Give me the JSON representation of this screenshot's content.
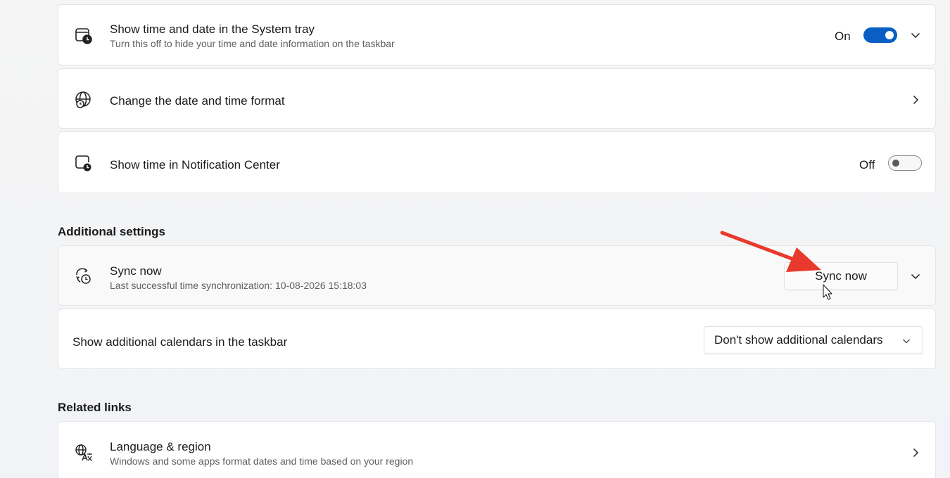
{
  "colors": {
    "accent": "#0a5fc4",
    "annotation_arrow": "#e8392c"
  },
  "time_settings": {
    "system_tray": {
      "icon": "calendar-clock-icon",
      "title": "Show time and date in the System tray",
      "subtitle": "Turn this off to hide your time and date information on the taskbar",
      "state_label": "On",
      "toggle_on": true
    },
    "date_format": {
      "icon": "globe-clock-icon",
      "title": "Change the date and time format"
    },
    "notification_center": {
      "icon": "screen-clock-icon",
      "title": "Show time in Notification Center",
      "state_label": "Off",
      "toggle_on": false
    }
  },
  "additional_settings": {
    "header": "Additional settings",
    "sync": {
      "icon": "sync-clock-icon",
      "title": "Sync now",
      "subtitle": "Last successful time synchronization: 10-08-2026 15:18:03",
      "button_label": "Sync now"
    },
    "calendars": {
      "title": "Show additional calendars in the taskbar",
      "selected": "Don't show additional calendars"
    }
  },
  "related_links": {
    "header": "Related links",
    "language_region": {
      "icon": "language-icon",
      "title": "Language & region",
      "subtitle": "Windows and some apps format dates and time based on your region"
    }
  }
}
